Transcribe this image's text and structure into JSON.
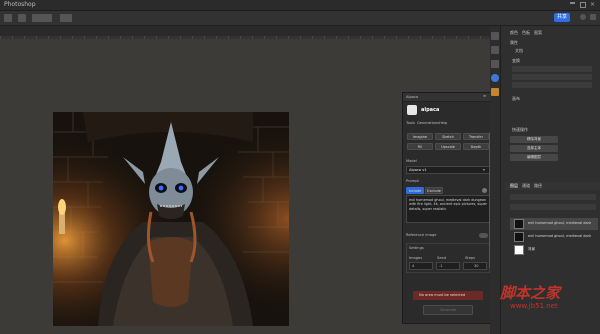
{
  "app": {
    "title": "Photoshop"
  },
  "toolbar": {
    "share_label": "共享"
  },
  "plugin": {
    "panel_title": "Alpaca",
    "name": "alpaca",
    "nav": [
      "Tools",
      "Generations",
      "Help"
    ],
    "modes": [
      "Imagine",
      "Sketch",
      "Transfer",
      "Fill",
      "Upscale",
      "Depth"
    ],
    "model_label": "Model",
    "model_value": "Alpaca v1",
    "prompt_label": "Prompt",
    "prompt_tabs": [
      "Include",
      "Exclude"
    ],
    "prompt_text": "evil homemod ghoul, medieval dark dungeon with fire light, 4k, ancient epic pictures, super details, super realistic",
    "reference_label": "Reference image",
    "settings_label": "Settings",
    "settings_cols": [
      "Images",
      "Seed",
      "Steps"
    ],
    "settings_values": [
      "4",
      "-1",
      "30"
    ],
    "warning": "No area must be selected",
    "generate": "Generate"
  },
  "right_panel": {
    "tabs": [
      "颜色",
      "色板",
      "图案"
    ],
    "properties": "属性",
    "doc": "文档",
    "transform": "变换",
    "canvas": "画布",
    "quick_actions": "快速操作",
    "buttons": [
      "移除背景",
      "选择主体",
      "编辑图层"
    ],
    "layers_tabs": [
      "图层",
      "通道",
      "路径"
    ],
    "layers": [
      {
        "name": "evil homemod ghoul, medieval dark"
      },
      {
        "name": "evil homemod ghoul, medieval dark"
      },
      {
        "name": "背景"
      }
    ]
  },
  "watermark": {
    "text": "脚本之家",
    "url": "www.jb51.net"
  }
}
